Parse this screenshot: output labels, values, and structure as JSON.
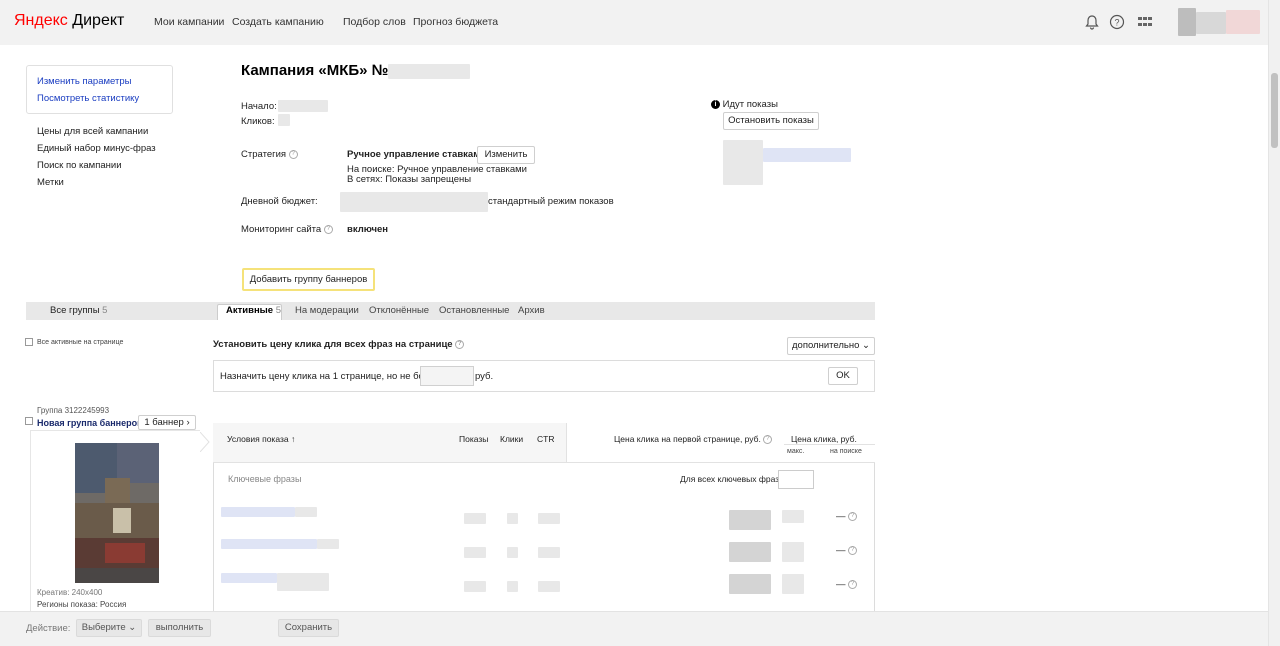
{
  "header": {
    "logo_brand": "Яндекс",
    "logo_product": "Директ",
    "nav": [
      "Мои кампании",
      "Создать кампанию",
      "Подбор слов",
      "Прогноз бюджета"
    ],
    "icons": [
      "bell-icon",
      "help-icon",
      "apps-grid-icon"
    ]
  },
  "sidebar": {
    "box_links": [
      "Изменить параметры",
      "Посмотреть статистику"
    ],
    "links": [
      "Цены для всей кампании",
      "Единый набор минус-фраз",
      "Поиск по кампании",
      "Метки"
    ]
  },
  "campaign": {
    "title": "Кампания «МКБ» №",
    "start_label": "Начало:",
    "clicks_label": "Кликов:",
    "strategy_label": "Стратегия",
    "strategy_value": "Ручное управление ставками",
    "strategy_change": "Изменить",
    "strategy_search": "На поиске: Ручное управление ставками",
    "strategy_network": "В сетях: Показы запрещены",
    "budget_label": "Дневной бюджет:",
    "budget_mode": "стандартный режим показов",
    "monitoring_label": "Мониторинг сайта",
    "monitoring_value": "включен",
    "add_group": "Добавить группу баннеров",
    "status": "Идут показы",
    "stop_button": "Остановить показы"
  },
  "tabs": {
    "all_groups": "Все группы",
    "all_groups_count": "5",
    "active": "Активные",
    "active_count": "5",
    "items": [
      "На модерации",
      "Отклонённые",
      "Остановленные",
      "Архив"
    ]
  },
  "price": {
    "all_active": "Все активные на странице",
    "set_price": "Установить цену клика для всех фраз на странице",
    "more": "дополнительно",
    "assign_prefix": "Назначить цену клика на 1 странице, но не более",
    "assign_suffix": "руб.",
    "ok": "OK"
  },
  "group": {
    "id": "Группа 3122245993",
    "name": "Новая группа баннеров",
    "banners": "1 баннер",
    "creative": "Креатив: 240x400",
    "regions": "Регионы показа: Россия"
  },
  "table": {
    "columns": [
      "Условия показа ↑",
      "Показы",
      "Клики",
      "CTR",
      "Цена клика на первой странице, руб.",
      "Цена клика, руб."
    ],
    "subcols": [
      "макс.",
      "на поиске"
    ],
    "keywords": "Ключевые фразы",
    "for_all": "Для всех ключевых фраз:",
    "dash": "—"
  },
  "footer": {
    "action_label": "Действие:",
    "choose": "Выберите",
    "execute": "выполнить",
    "save": "Сохранить"
  }
}
